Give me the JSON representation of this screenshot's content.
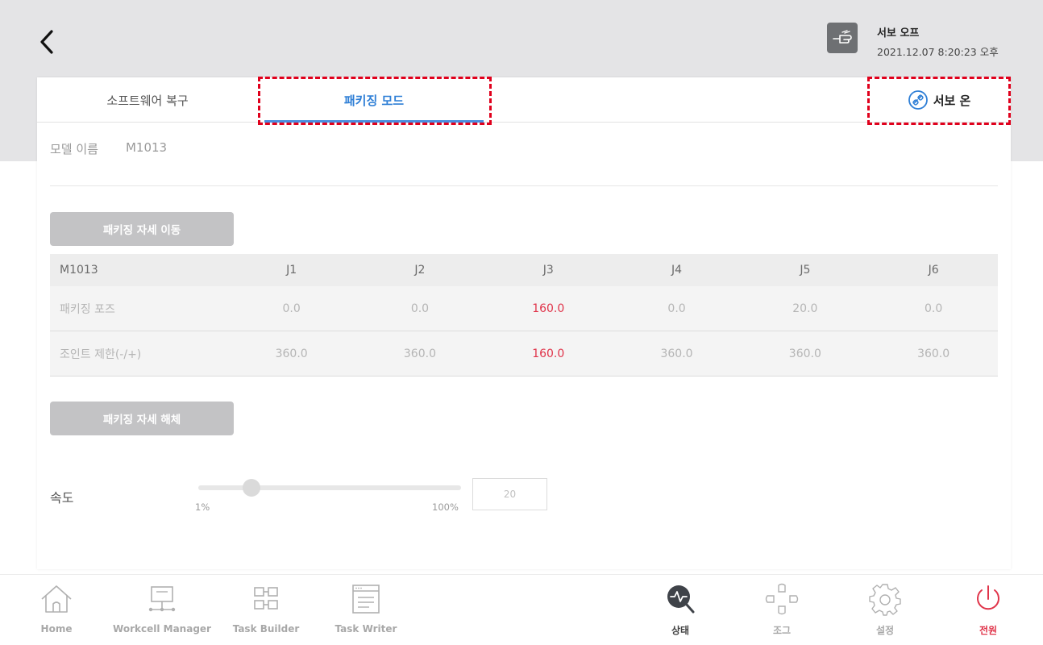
{
  "header": {
    "servo_status_title": "서보 오프",
    "datetime": "2021.12.07 8:20:23 오후"
  },
  "tabs": {
    "recovery": "소프트웨어 복구",
    "packing": "패키징 모드",
    "servo_on": "서보 온"
  },
  "model": {
    "label": "모델 이름",
    "value": "M1013"
  },
  "buttons": {
    "move": "패키징 자세 이동",
    "release": "패키징 자세 해체"
  },
  "table": {
    "header": [
      "M1013",
      "J1",
      "J2",
      "J3",
      "J4",
      "J5",
      "J6"
    ],
    "rows": [
      [
        "패키징 포즈",
        "0.0",
        "0.0",
        "160.0",
        "0.0",
        "20.0",
        "0.0"
      ],
      [
        "조인트 제한(-/+)",
        "360.0",
        "360.0",
        "160.0",
        "360.0",
        "360.0",
        "360.0"
      ]
    ],
    "highlight_color": "#e0344a"
  },
  "speed": {
    "label": "속도",
    "min_label": "1%",
    "max_label": "100%",
    "value": "20",
    "percent": 20
  },
  "nav": {
    "items": [
      {
        "label": "Home",
        "icon": "home-icon"
      },
      {
        "label": "Workcell Manager",
        "icon": "workcell-icon"
      },
      {
        "label": "Task Builder",
        "icon": "task-builder-icon"
      },
      {
        "label": "Task Writer",
        "icon": "task-writer-icon"
      },
      {
        "label": "상태",
        "icon": "status-icon"
      },
      {
        "label": "조그",
        "icon": "jog-icon"
      },
      {
        "label": "설정",
        "icon": "settings-icon"
      },
      {
        "label": "전원",
        "icon": "power-icon"
      }
    ]
  },
  "colors": {
    "accent": "#2f7fd6",
    "annotation_outline": "#e0001c",
    "power": "#e0344a"
  }
}
